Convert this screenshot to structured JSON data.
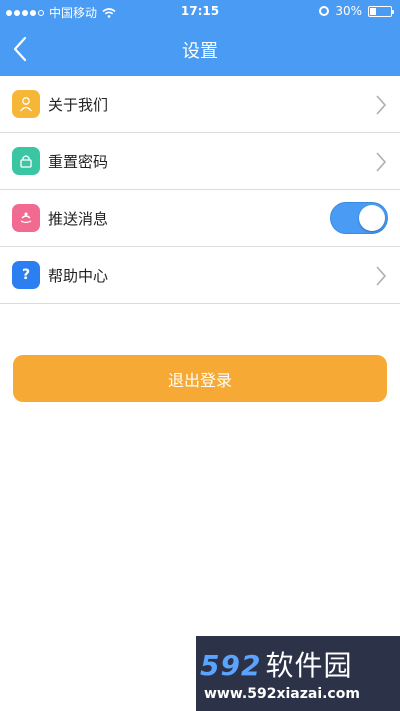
{
  "status_bar": {
    "carrier": "中国移动",
    "time": "17:15",
    "battery_text": "30%",
    "battery_level": 0.3
  },
  "nav": {
    "title": "设置"
  },
  "menu": {
    "items": [
      {
        "label": "关于我们",
        "icon": "user-icon",
        "color": "#f6b638"
      },
      {
        "label": "重置密码",
        "icon": "lock-icon",
        "color": "#3ac6a3"
      },
      {
        "label": "推送消息",
        "icon": "push-icon",
        "color": "#f06b8f",
        "toggle_on": true
      },
      {
        "label": "帮助中心",
        "icon": "question-icon",
        "color": "#2b7ff0",
        "glyph": "?"
      }
    ]
  },
  "logout": {
    "label": "退出登录"
  },
  "watermark": {
    "brand_number": "592",
    "brand_text": "软件园",
    "url": "www.592xiazai.com"
  },
  "colors": {
    "header": "#4a9bf3",
    "logout": "#f6a935"
  }
}
